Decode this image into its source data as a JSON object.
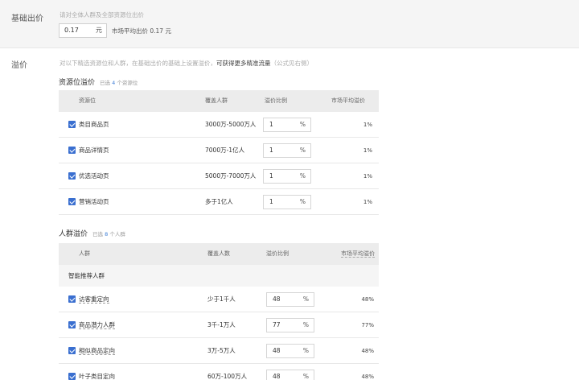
{
  "base": {
    "label": "基础出价",
    "hint": "请对全体人群及全部资源位出价",
    "input_value": "0.17",
    "unit": "元",
    "market_text": "市场平均出价 0.17 元"
  },
  "premium": {
    "label": "溢价",
    "hint_prefix": "对以下精选资源位和人群，在基础出价的基础上设置溢价，",
    "hint_bold": "可获得更多精准流量",
    "hint_suffix": "（公式见右侧）"
  },
  "resource": {
    "title": "资源位溢价",
    "count_prefix": "已选",
    "count_num": "4",
    "count_suffix": "个资源位",
    "headers": {
      "name": "资源位",
      "coverage": "覆盖人群",
      "ratio": "溢价比例",
      "market": "市场平均溢价"
    },
    "rows": [
      {
        "name": "类目商品页",
        "coverage": "3000万-5000万人",
        "ratio": "1",
        "unit": "%",
        "market": "1%"
      },
      {
        "name": "商品详情页",
        "coverage": "7000万-1亿人",
        "ratio": "1",
        "unit": "%",
        "market": "1%"
      },
      {
        "name": "优选活动页",
        "coverage": "5000万-7000万人",
        "ratio": "1",
        "unit": "%",
        "market": "1%"
      },
      {
        "name": "营销活动页",
        "coverage": "多于1亿人",
        "ratio": "1",
        "unit": "%",
        "market": "1%"
      }
    ]
  },
  "crowd": {
    "title": "人群溢价",
    "count_prefix": "已选",
    "count_num": "8",
    "count_suffix": "个人群",
    "headers": {
      "name": "人群",
      "coverage": "覆盖人数",
      "ratio": "溢价比例",
      "market": "市场平均溢价"
    },
    "group_label": "智能推荐人群",
    "rows": [
      {
        "name": "访客重定向",
        "coverage": "少于1千人",
        "ratio": "48",
        "unit": "%",
        "market": "48%"
      },
      {
        "name": "商品潜力人群",
        "coverage": "3千-1万人",
        "ratio": "77",
        "unit": "%",
        "market": "77%"
      },
      {
        "name": "相似商品定向",
        "coverage": "3万-5万人",
        "ratio": "48",
        "unit": "%",
        "market": "48%"
      },
      {
        "name": "叶子类目定向",
        "coverage": "60万-100万人",
        "ratio": "48",
        "unit": "%",
        "market": "48%"
      }
    ]
  }
}
